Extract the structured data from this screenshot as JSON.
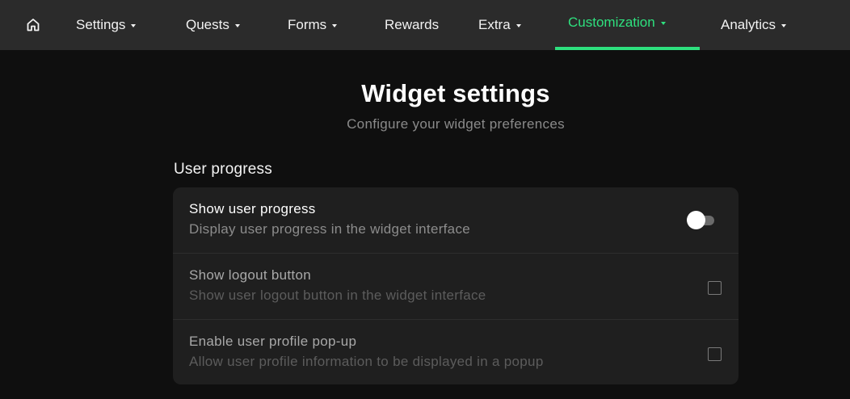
{
  "nav": {
    "home_icon": "home-icon",
    "items": [
      {
        "label": "Settings",
        "has_dropdown": true
      },
      {
        "label": "Quests",
        "has_dropdown": true
      },
      {
        "label": "Forms",
        "has_dropdown": true
      },
      {
        "label": "Rewards",
        "has_dropdown": false
      },
      {
        "label": "Extra",
        "has_dropdown": true
      },
      {
        "label": "Customization",
        "has_dropdown": true,
        "active": true
      },
      {
        "label": "Analytics",
        "has_dropdown": true
      }
    ]
  },
  "page": {
    "title": "Widget settings",
    "subtitle": "Configure your widget preferences"
  },
  "section": {
    "title": "User progress",
    "settings": [
      {
        "label": "Show user progress",
        "description": "Display user progress in the widget interface",
        "control": "toggle",
        "enabled": false,
        "disabled": false
      },
      {
        "label": "Show logout button",
        "description": "Show user logout button in the widget interface",
        "control": "checkbox",
        "checked": false,
        "disabled": true
      },
      {
        "label": "Enable user profile pop-up",
        "description": "Allow user profile information to be displayed in a popup",
        "control": "checkbox",
        "checked": false,
        "disabled": true
      }
    ]
  },
  "colors": {
    "accent": "#2ee07e",
    "nav_background": "#2b2b2b",
    "page_background": "#0f0f0f",
    "card_background": "#1f1f1f"
  }
}
